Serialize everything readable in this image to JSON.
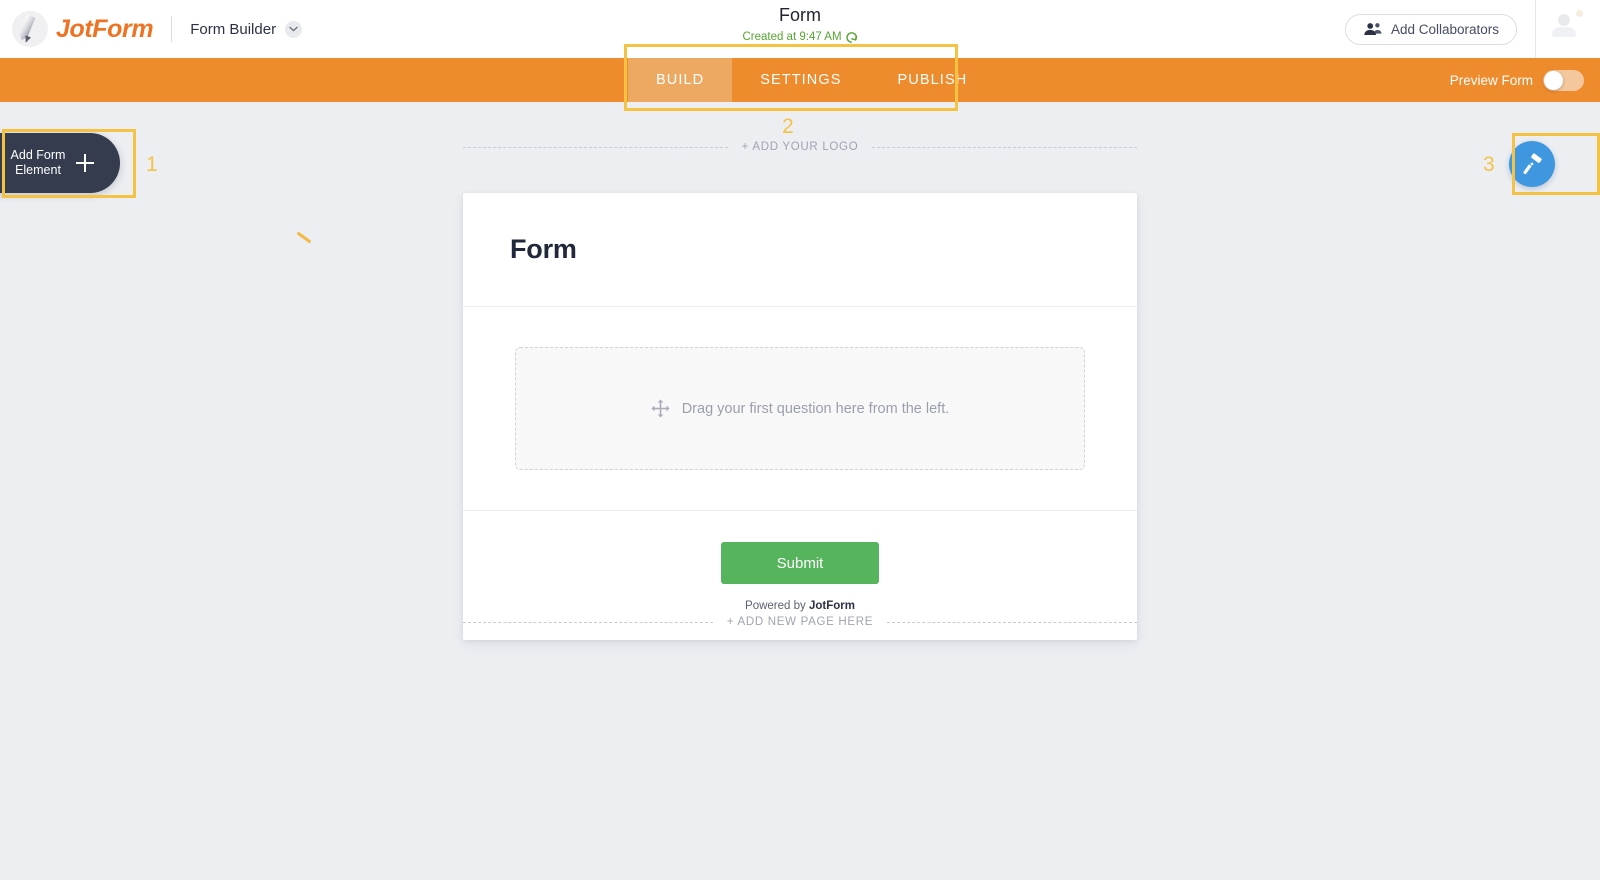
{
  "header": {
    "brand_name": "JotForm",
    "app_name": "Form Builder",
    "form_title": "Form",
    "saved_status": "Created at 9:47 AM",
    "collaborators_label": "Add Collaborators"
  },
  "nav": {
    "tabs": [
      {
        "label": "BUILD",
        "active": true
      },
      {
        "label": "SETTINGS",
        "active": false
      },
      {
        "label": "PUBLISH",
        "active": false
      }
    ],
    "preview_label": "Preview Form",
    "preview_enabled": false
  },
  "canvas": {
    "add_logo_label": "+ ADD YOUR LOGO",
    "add_page_label": "+ ADD NEW PAGE HERE",
    "form": {
      "heading": "Form",
      "dropzone_text": "Drag your first question here from the left.",
      "submit_label": "Submit",
      "powered_prefix": "Powered by ",
      "powered_brand": "JotForm"
    }
  },
  "left_panel": {
    "add_element_line1": "Add Form",
    "add_element_line2": "Element"
  },
  "annotations": {
    "one": "1",
    "two": "2",
    "three": "3"
  },
  "colors": {
    "brand_orange": "#ee7424",
    "nav_orange": "#ee8b2d",
    "nav_active_orange": "#eda961",
    "submit_green": "#56b45d",
    "saved_green": "#55a630",
    "paint_blue": "#3f97e0",
    "dark_navy": "#343c4e",
    "annotation_yellow": "#f5c344",
    "canvas_bg": "#eceef2"
  }
}
